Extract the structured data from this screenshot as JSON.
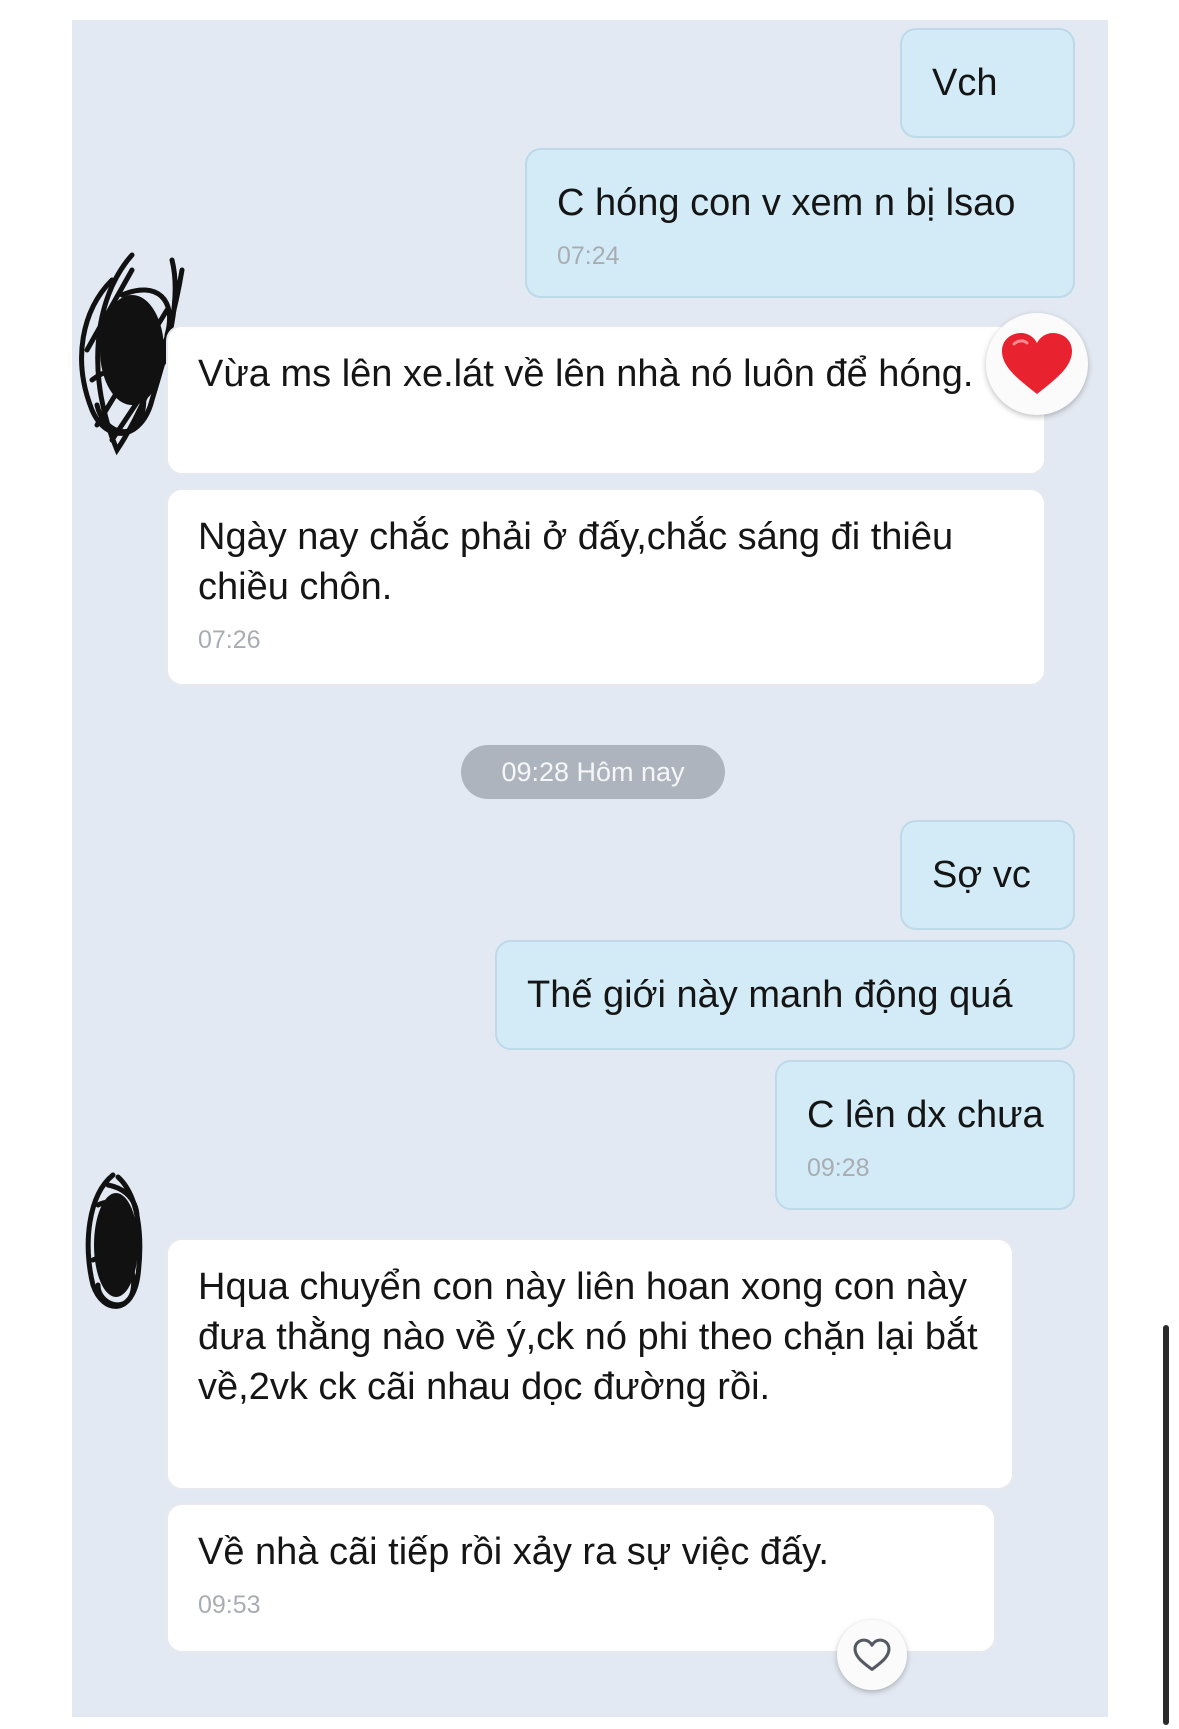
{
  "messages": {
    "m1": {
      "text": "Vch"
    },
    "m2": {
      "text": "C hóng con v xem n bị lsao",
      "time": "07:24"
    },
    "m3": {
      "text": "Vừa ms lên xe.lát về lên nhà nó luôn để hóng."
    },
    "m4": {
      "text": "Ngày nay chắc phải ở đấy,chắc sáng đi thiêu chiều chôn.",
      "time": "07:26"
    },
    "m5": {
      "text": "Sợ vc"
    },
    "m6": {
      "text": "Thế giới này manh động quá"
    },
    "m7": {
      "text": "C lên dx chưa",
      "time": "09:28"
    },
    "m8": {
      "text": "Hqua chuyển con này liên hoan xong con này đưa thằng nào về ý,ck nó phi theo chặn lại bắt về,2vk ck cãi nhau dọc đường rồi."
    },
    "m9": {
      "text": "Về nhà cãi tiếp rồi xảy ra sự việc đấy.",
      "time": "09:53"
    }
  },
  "divider": {
    "text": "09:28 Hôm nay"
  },
  "reactions": {
    "heart_filled_color": "#e8232f",
    "heart_outline_color": "#555a62"
  },
  "colors": {
    "background": "#e3e9f2",
    "outgoing_bubble": "#d2ebf7",
    "incoming_bubble": "#ffffff"
  }
}
